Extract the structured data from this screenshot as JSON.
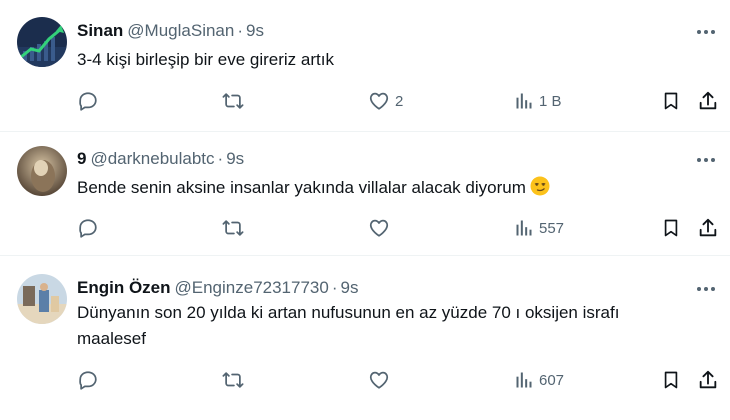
{
  "tweets": [
    {
      "name": "Sinan",
      "handle": "@MuglaSinan",
      "separator": "·",
      "time": "9s",
      "text_lines": [
        "3-4 kişi birleşip bir eve gireriz artık"
      ],
      "replies": "",
      "retweets": "",
      "likes": "2",
      "views": "1 B",
      "avatar_colors": [
        "#1a2c4a",
        "#2ecc71"
      ]
    },
    {
      "name": "9",
      "handle": "@darknebulabtc",
      "separator": "·",
      "time": "9s",
      "text_lines": [
        "Bende senin aksine insanlar yakında villalar alacak diyorum"
      ],
      "emoji_icon": "smirking-face-emoji",
      "replies": "",
      "retweets": "",
      "likes": "",
      "views": "557",
      "avatar_colors": [
        "#6b5846",
        "#c9b79c"
      ]
    },
    {
      "name": "Engin Özen",
      "handle": "@Enginze72317730",
      "separator": "·",
      "time": "9s",
      "text_lines": [
        "Dünyanın son 20 yılda ki artan nufusunun en az yüzde 70 ı oksijen israfı",
        "maalesef"
      ],
      "replies": "",
      "retweets": "",
      "likes": "",
      "views": "607",
      "avatar_colors": [
        "#b6c9d9",
        "#e8dcc4"
      ]
    }
  ],
  "icons": {
    "reply": "reply-icon",
    "retweet": "retweet-icon",
    "like": "heart-icon",
    "views": "analytics-icon",
    "bookmark": "bookmark-icon",
    "share": "share-icon",
    "more": "more-options-icon"
  },
  "colors": {
    "text": "#0f1419",
    "secondary": "#536471",
    "divider": "#eff3f4"
  }
}
